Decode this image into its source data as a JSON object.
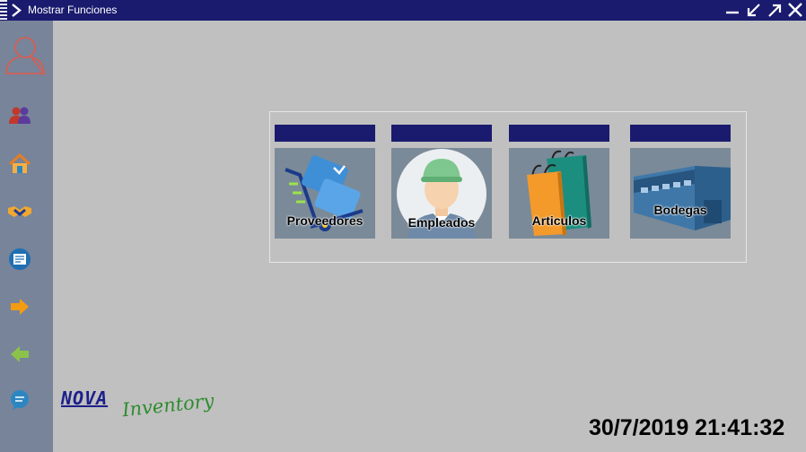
{
  "window": {
    "title": "Mostrar Funciones"
  },
  "sidebar": {
    "items": [
      {
        "icon": "users-icon"
      },
      {
        "icon": "home-icon"
      },
      {
        "icon": "handshake-icon"
      },
      {
        "icon": "document-icon"
      },
      {
        "icon": "arrow-right-icon"
      },
      {
        "icon": "arrow-left-icon"
      },
      {
        "icon": "chat-icon"
      }
    ]
  },
  "tiles": [
    {
      "label": "Proveedores",
      "icon": "delivery-cart-icon"
    },
    {
      "label": "Empleados",
      "icon": "worker-icon"
    },
    {
      "label": "Articulos",
      "icon": "shopping-bags-icon"
    },
    {
      "label": "Bodegas",
      "icon": "warehouse-icon"
    }
  ],
  "logo": {
    "brand": "NOVA",
    "product": "Inventory"
  },
  "clock": "30/7/2019 21:41:32",
  "colors": {
    "titlebar": "#1a1b6e",
    "sidebar": "#78849a",
    "background": "#c0c0c0",
    "tile_bg": "#7a8a98"
  }
}
